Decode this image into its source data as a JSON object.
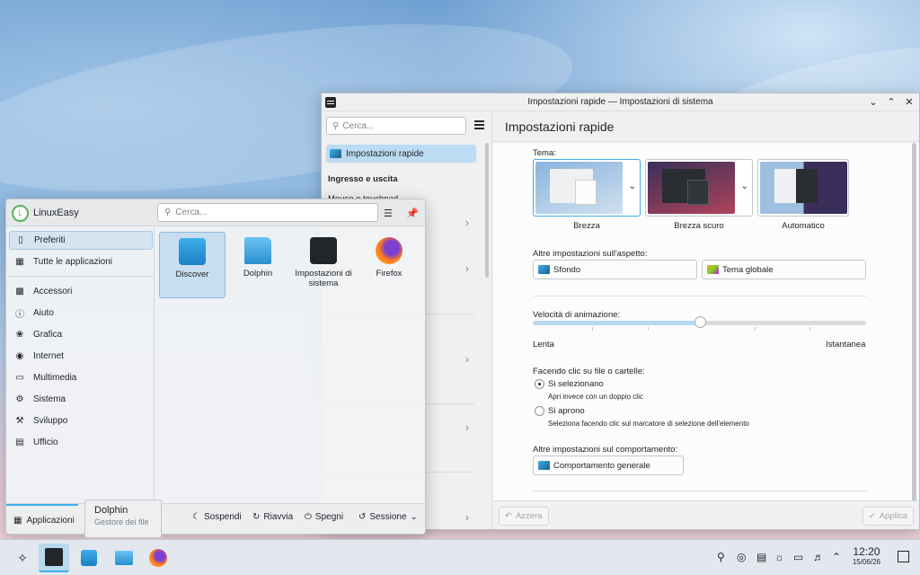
{
  "settings_window": {
    "title": "Impostazioni rapide — Impostazioni di sistema",
    "search_placeholder": "Cerca...",
    "sidebar_selected": "Impostazioni rapide",
    "sidebar_section": "Ingresso e uscita",
    "sidebar_partial": "Mouse e touchpad",
    "page_title": "Impostazioni rapide",
    "theme_label": "Tema:",
    "themes": [
      "Brezza",
      "Brezza scuro",
      "Automatico"
    ],
    "appearance_label": "Altre impostazioni sull'aspetto:",
    "wallpaper_button": "Sfondo",
    "global_theme_button": "Tema globale",
    "animation_label": "Velocità di animazione:",
    "animation_min": "Lenta",
    "animation_max": "Istantanea",
    "animation_value": 0.5,
    "click_label": "Facendo clic su file o cartelle:",
    "radio_select": "Si selezionano",
    "radio_select_desc": "Apri invece con un doppio clic",
    "radio_open": "Si aprono",
    "radio_open_desc": "Seleziona facendo clic sul marcatore di selezione dell'elemento",
    "behavior_label": "Altre impostazioni sul comportamento:",
    "general_behavior_button": "Comportamento generale",
    "reset_button": "Azzera",
    "apply_button": "Applica"
  },
  "launcher": {
    "user": "LinuxEasy",
    "user_initial": "L",
    "search_placeholder": "Cerca...",
    "categories": [
      "Preferiti",
      "Tutte le applicazioni",
      "Accessori",
      "Aiuto",
      "Grafica",
      "Internet",
      "Multimedia",
      "Sistema",
      "Sviluppo",
      "Ufficio"
    ],
    "apps": [
      "Discover",
      "Dolphin",
      "Impostazioni di sistema",
      "Firefox"
    ],
    "applications_tab": "Applicazioni",
    "suspend": "Sospendi",
    "restart": "Riavvia",
    "shutdown": "Spegni",
    "session": "Sessione"
  },
  "tooltip": {
    "title": "Dolphin",
    "subtitle": "Gestore dei file"
  },
  "taskbar": {
    "time": "12:20",
    "date": "15/06/26"
  },
  "colors": {
    "accent": "#3daee9",
    "selection": "#bcdcf3"
  }
}
